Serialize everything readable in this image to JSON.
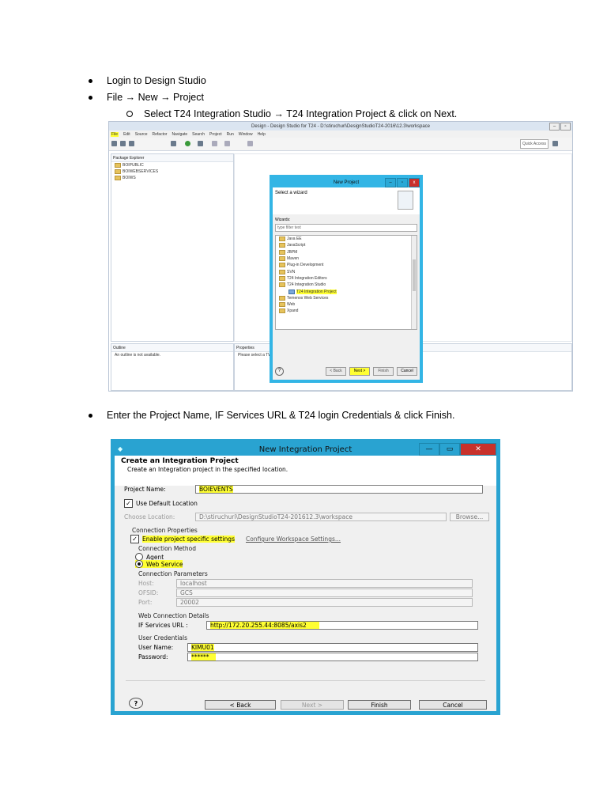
{
  "instructions": {
    "bullet1": "Login to Design Studio",
    "bullet2": "File → New → Project",
    "sub1": "Select T24 Integration Studio → T24 Integration Project & click on Next.",
    "bullet3": "Enter the Project Name, IF Services URL & T24 login Credentials & click Finish."
  },
  "eclipse": {
    "window_title": "Design - Design Studio for T24 - D:\\stiruchuri\\DesignStudioT24-2016\\12.3\\workspace",
    "menu": [
      "File",
      "Edit",
      "Source",
      "Refactor",
      "Navigate",
      "Search",
      "Project",
      "Run",
      "Window",
      "Help"
    ],
    "quick_access": "Quick Access",
    "package_explorer": {
      "tab": "Package Explorer",
      "items": [
        "BOIPUBLIC",
        "BOIWEBSERVICES",
        "BOIWS"
      ]
    },
    "outline": {
      "tab": "Outline",
      "message": "An outline is not available."
    },
    "properties": {
      "tab": "Properties",
      "message": "Please select a TWS p"
    }
  },
  "wizard": {
    "title": "New Project",
    "heading": "Select a wizard",
    "wizards_label": "Wizards:",
    "filter_placeholder": "type filter text",
    "tree": [
      "Java EE",
      "JavaScript",
      "JBPM",
      "Maven",
      "Plug-in Development",
      "SVN",
      "T24 Integration Editors",
      "T24 Integration Studio",
      "T24 Integration Project",
      "Temenos Web Services",
      "Web",
      "Xpand"
    ],
    "buttons": {
      "back": "< Back",
      "next": "Next >",
      "finish": "Finish",
      "cancel": "Cancel"
    }
  },
  "integration_dialog": {
    "title": "New Integration Project",
    "heading": "Create an Integration Project",
    "subheading": "Create an Integration project in the specified location.",
    "project_name_label": "Project Name:",
    "project_name_value": "BOIEVENTS",
    "use_default_location": "Use Default Location",
    "choose_location_label": "Choose Location:",
    "choose_location_value": "D:\\stiruchuri\\DesignStudioT24-201612.3\\workspace",
    "browse": "Browse...",
    "connection_properties": "Connection Properties",
    "enable_project_specific": "Enable project specific settings",
    "configure_workspace": "Configure Workspace Settings...",
    "connection_method": "Connection Method",
    "agent": "Agent",
    "web_service": "Web Service",
    "connection_parameters": "Connection Parameters",
    "host_label": "Host:",
    "host_value": "localhost",
    "ofsid_label": "OFSID:",
    "ofsid_value": "GCS",
    "port_label": "Port:",
    "port_value": "20002",
    "web_connection_details": "Web Connection Details",
    "if_services_url_label": "IF Services URL :",
    "if_services_url_value": "http://172.20.255.44:8085/axis2",
    "user_credentials": "User Credentials",
    "user_name_label": "User Name:",
    "user_name_value": "KIMU01",
    "password_label": "Password:",
    "password_value": "******",
    "buttons": {
      "back": "< Back",
      "next": "Next >",
      "finish": "Finish",
      "cancel": "Cancel"
    }
  }
}
